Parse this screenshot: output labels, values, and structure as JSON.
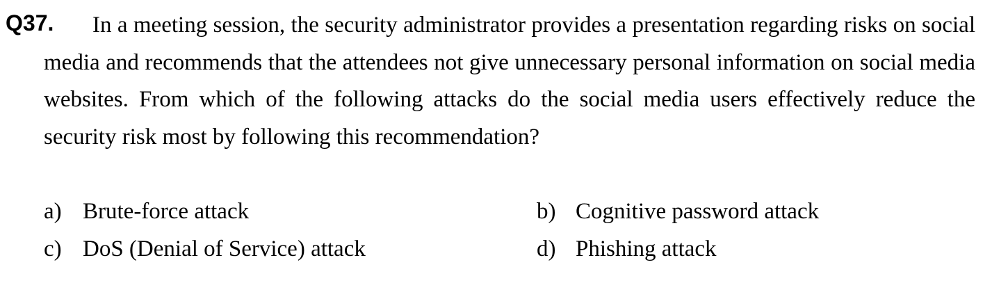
{
  "question": {
    "number": "Q37.",
    "text": "In a meeting session, the security administrator provides a presentation regarding risks on social media and recommends that the attendees not give unnecessary personal information on social media websites. From which of the following attacks do the social media users effectively reduce the security risk most by following this recommendation?"
  },
  "options": [
    {
      "letter": "a)",
      "text": "Brute-force attack"
    },
    {
      "letter": "b)",
      "text": "Cognitive password attack"
    },
    {
      "letter": "c)",
      "text": "DoS (Denial of Service) attack"
    },
    {
      "letter": "d)",
      "text": "Phishing attack"
    }
  ]
}
